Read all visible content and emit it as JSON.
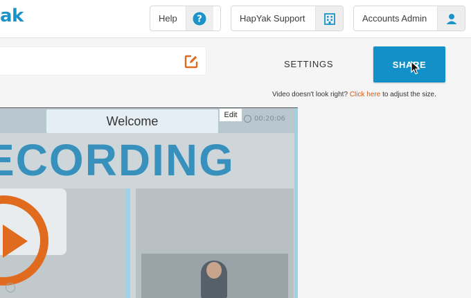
{
  "header": {
    "logo_text": "ak",
    "help_label": "Help",
    "support_label": "HapYak Support",
    "admin_label": "Accounts Admin"
  },
  "editor": {
    "title_value": "",
    "settings_label": "SETTINGS",
    "share_label": "SHARE"
  },
  "size_note": {
    "prefix": "Video doesn't look right?",
    "link": "Click here",
    "suffix": "to adjust the size."
  },
  "video": {
    "welcome_label": "Welcome",
    "edit_label": "Edit",
    "timer": "00:20:06",
    "overlay_text": "ECORDING"
  },
  "colors": {
    "brand": "#1a93c9",
    "share_bg": "#1490c8",
    "link": "#d45a1c",
    "accent_orange": "#e06a1d"
  }
}
